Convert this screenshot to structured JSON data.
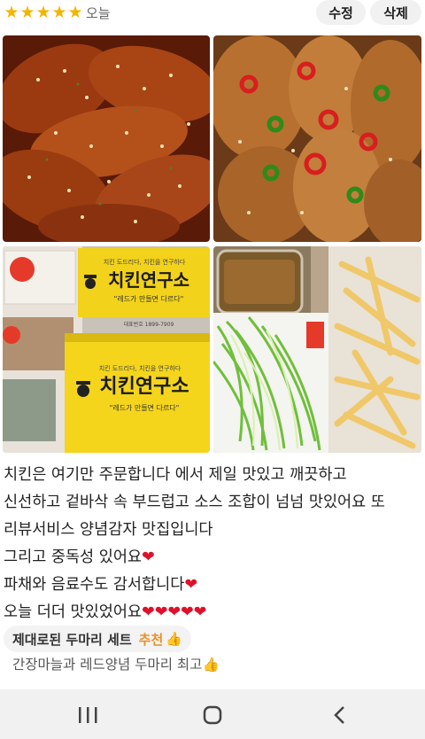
{
  "header": {
    "star_count": 5,
    "stars": [
      "★",
      "★",
      "★",
      "★",
      "★"
    ],
    "date": "오늘",
    "edit_label": "수정",
    "delete_label": "삭제"
  },
  "photos": [
    {
      "subject": "glazed chicken wings"
    },
    {
      "subject": "fried chicken with peppers"
    },
    {
      "subject": "chicken boxes",
      "box_brand": "치킨연구소",
      "box_slogan": "\"레드가 만들면 다르다\"",
      "box_top": "치킨 도드리다, 치킨을 연구하다",
      "box_phone": "대표번호 1899-7909"
    },
    {
      "subject": "green onion salad and fries"
    }
  ],
  "review": {
    "lines": [
      "치킨은 여기만 주문합니다          에서 제일 맛있고 깨끗하고",
      "신선하고 겉바삭 속 부드럽고 소스 조합이 넘넘 맛있어요 또",
      "리뷰서비스 양념감자 맛집입니다",
      "그리고 중독성 있어요",
      "파채와 음료수도 감서합니다",
      "오늘 더더 맛있었어요"
    ],
    "line4_hearts": "❤",
    "line5_hearts": "❤",
    "line6_hearts": "❤❤❤❤❤"
  },
  "tag": {
    "title": "제대로된 두마리 세트",
    "recommend": "추천",
    "thumb": "👍"
  },
  "comment": {
    "text": "간장마늘과 레드양념 두마리 최고",
    "emoji": "👍"
  },
  "colors": {
    "star": "#f5b400",
    "heart": "#e0102a",
    "recommend": "#e8922a",
    "button_bg": "#f1f1f1"
  },
  "icons": {
    "recent_apps": "recent-apps-icon",
    "home": "home-icon",
    "back": "back-icon"
  }
}
